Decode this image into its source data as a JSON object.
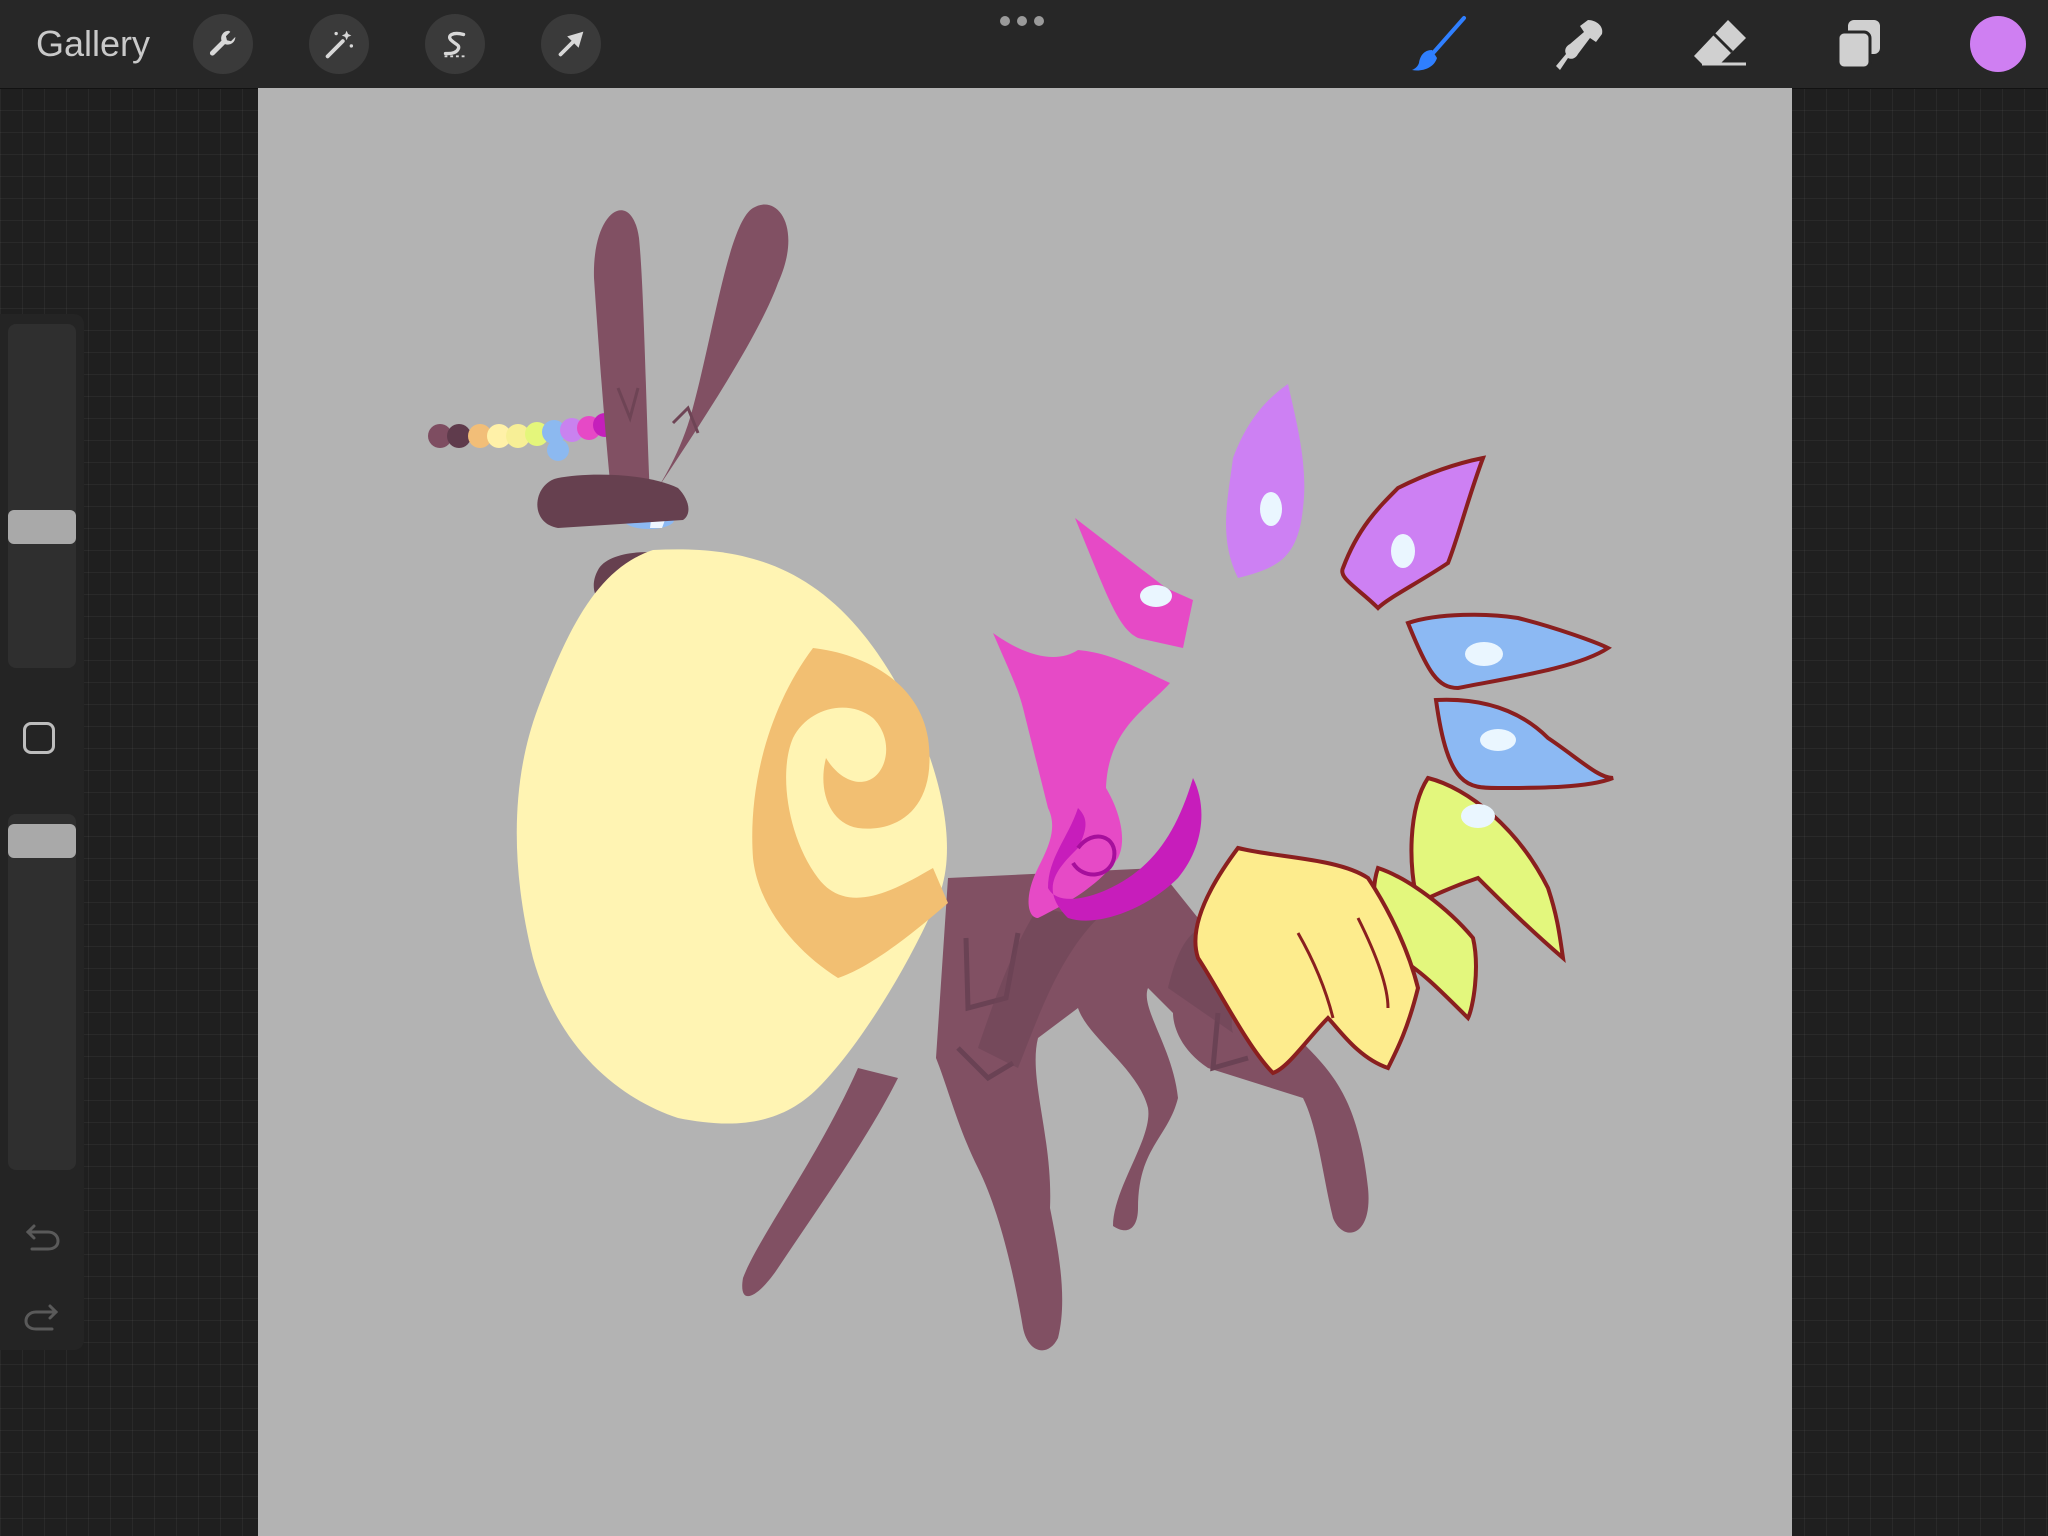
{
  "topbar": {
    "gallery_label": "Gallery",
    "left_tools": [
      {
        "name": "adjust-settings",
        "icon": "wrench-icon"
      },
      {
        "name": "adjustments",
        "icon": "magic-wand-icon"
      },
      {
        "name": "selection",
        "icon": "selection-s-icon"
      },
      {
        "name": "transform",
        "icon": "arrow-cursor-icon"
      }
    ],
    "right_tools": [
      {
        "name": "brush",
        "icon": "brush-icon",
        "active": true
      },
      {
        "name": "smudge",
        "icon": "smudge-icon"
      },
      {
        "name": "eraser",
        "icon": "eraser-icon"
      },
      {
        "name": "layers",
        "icon": "layers-icon"
      }
    ],
    "current_color": "#cf7ff2",
    "active_tool_color": "#2f7fff"
  },
  "sidebar": {
    "brush_size_level": 0.4,
    "opacity_level": 0.97,
    "modify_button_icon": "square-icon",
    "undo_icon": "undo-icon",
    "redo_icon": "redo-icon"
  },
  "artwork": {
    "palette_dots": [
      "#7e4d61",
      "#5f3b4c",
      "#f2be78",
      "#fff1a8",
      "#f7ef96",
      "#e4f67b",
      "#8cb9f0",
      "#c982ef",
      "#e649c6",
      "#c51fbb"
    ],
    "colors": {
      "background": "#b3b3b3",
      "body": "#815063",
      "body_dark": "#66404f",
      "shell": "#fff4b3",
      "shell_spiral": "#f2bf72",
      "pink": "#e64ac6",
      "magenta": "#c71dbb",
      "lilac": "#cd80f3",
      "blue": "#8cb9f3",
      "lime": "#e3f77d",
      "yellow": "#fdec8d",
      "outline": "#8a1f1f",
      "eye": "#8cb9f3"
    }
  }
}
